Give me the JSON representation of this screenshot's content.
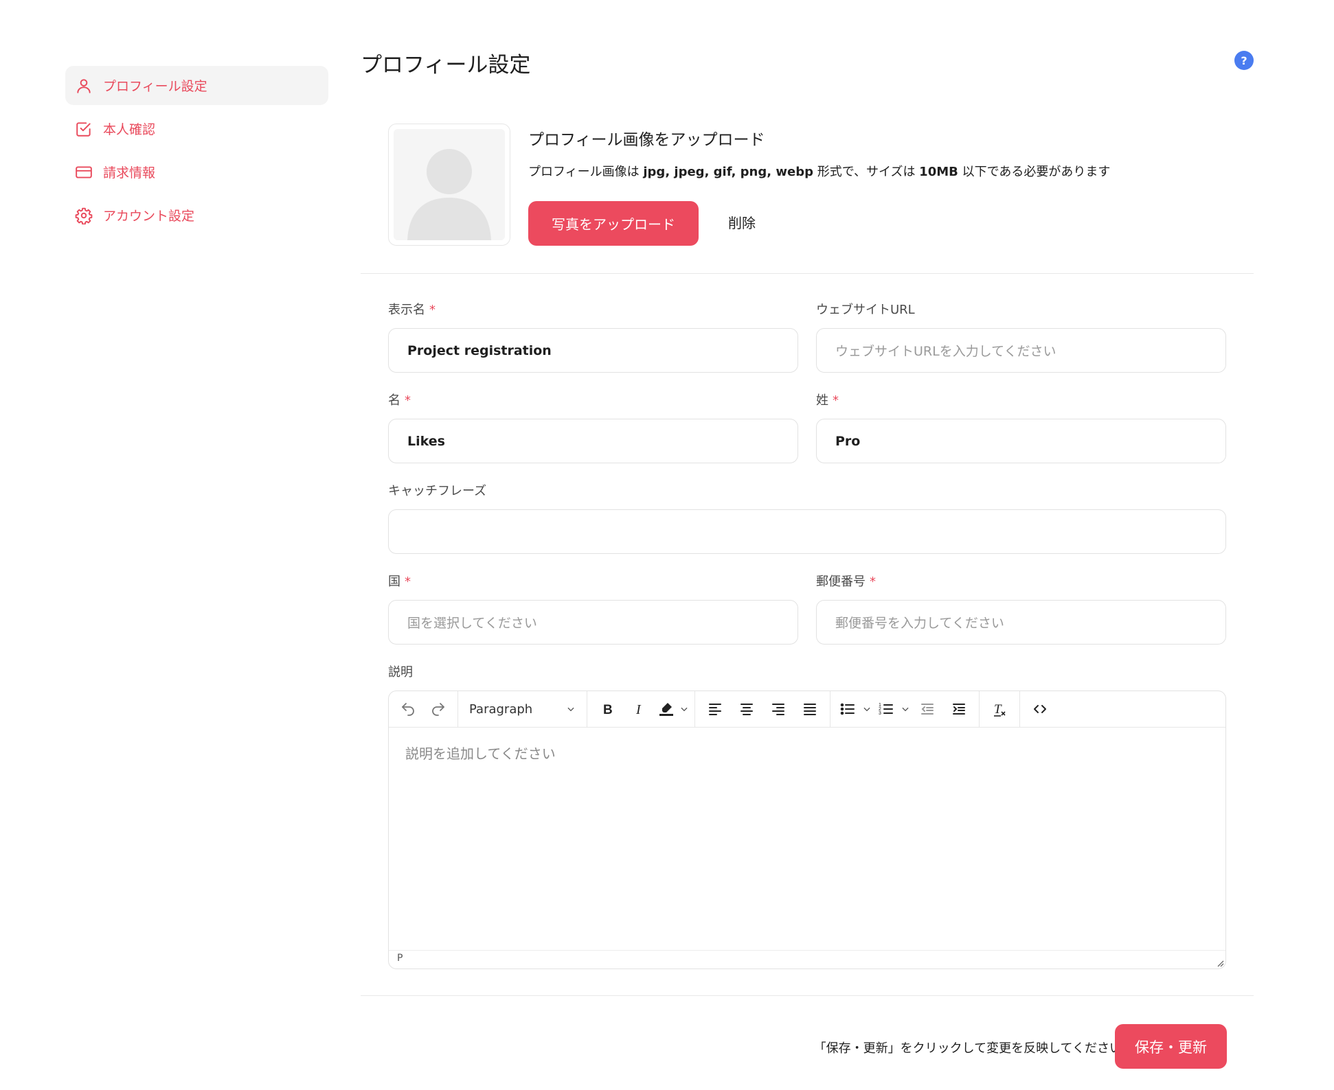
{
  "sidebar": {
    "items": [
      {
        "label": "プロフィール設定",
        "icon": "user-icon",
        "active": true
      },
      {
        "label": "本人確認",
        "icon": "check-square-icon"
      },
      {
        "label": "請求情報",
        "icon": "credit-card-icon"
      },
      {
        "label": "アカウント設定",
        "icon": "gear-icon"
      }
    ]
  },
  "page": {
    "title": "プロフィール設定",
    "help_label": "?"
  },
  "upload": {
    "title": "プロフィール画像をアップロード",
    "desc_prefix": "プロフィール画像は ",
    "desc_formats": "jpg, jpeg, gif, png, webp",
    "desc_mid": " 形式で、サイズは ",
    "desc_size": "10MB",
    "desc_suffix": " 以下である必要があります",
    "upload_button": "写真をアップロード",
    "delete_button": "削除"
  },
  "form": {
    "display_name": {
      "label": "表示名",
      "required": "*",
      "value": "Project registration"
    },
    "website": {
      "label": "ウェブサイトURL",
      "placeholder": "ウェブサイトURLを入力してください"
    },
    "first_name": {
      "label": "名",
      "required": "*",
      "value": "Likes"
    },
    "last_name": {
      "label": "姓",
      "required": "*",
      "value": "Pro"
    },
    "catchphrase": {
      "label": "キャッチフレーズ",
      "value": ""
    },
    "country": {
      "label": "国",
      "required": "*",
      "placeholder": "国を選択してください"
    },
    "postal_code": {
      "label": "郵便番号",
      "required": "*",
      "placeholder": "郵便番号を入力してください"
    },
    "description": {
      "label": "説明",
      "placeholder": "説明を追加してください"
    }
  },
  "editor": {
    "block_format": "Paragraph",
    "status_path": "P"
  },
  "footer": {
    "note": "「保存・更新」をクリックして変更を反映してください",
    "save_button": "保存・更新"
  },
  "colors": {
    "accent": "#ec4a5e",
    "help": "#4a7cf0"
  }
}
